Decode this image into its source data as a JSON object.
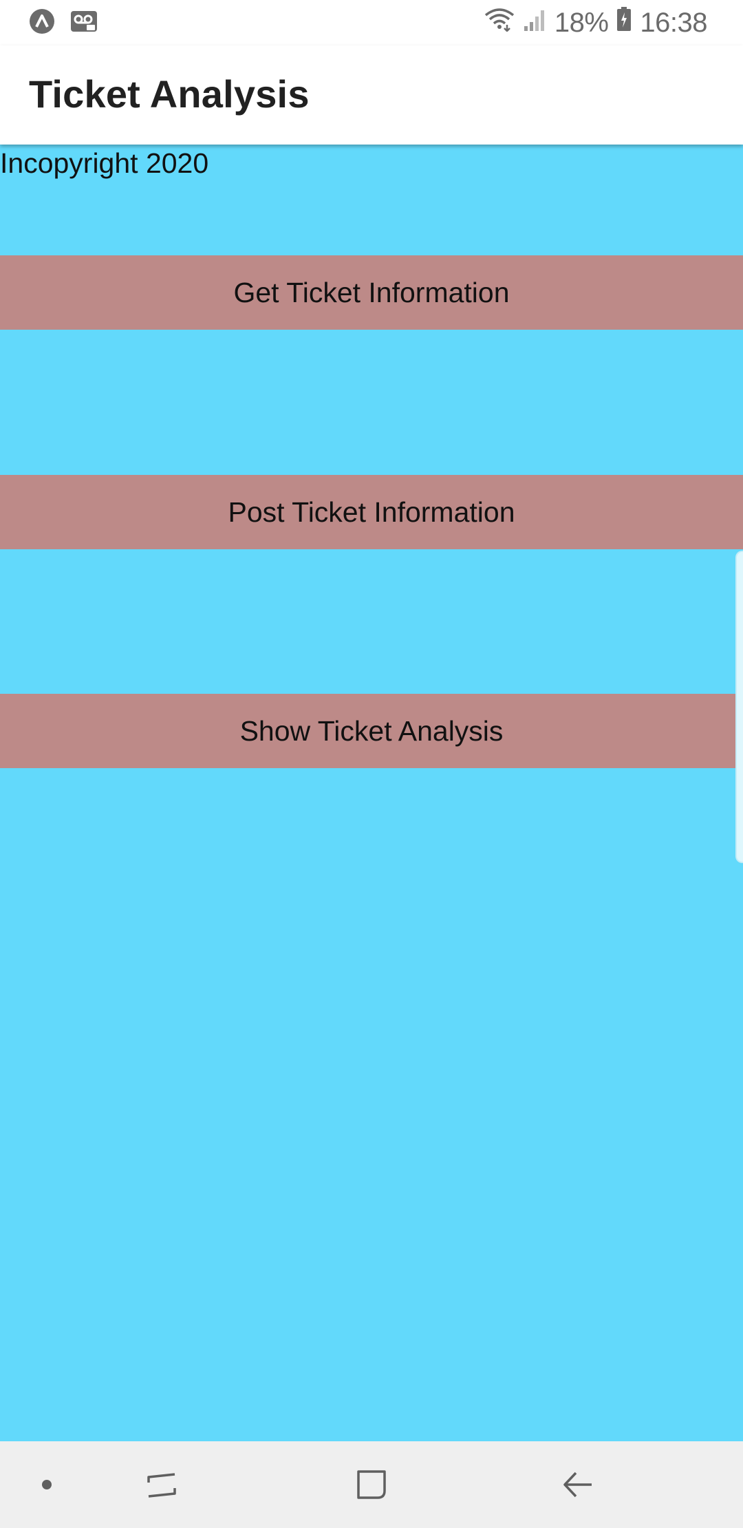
{
  "status_bar": {
    "left_icons": [
      "app-notification-icon",
      "voicemail-icon"
    ],
    "right_icons": [
      "wifi-icon",
      "signal-icon",
      "battery-icon"
    ],
    "battery": "18%",
    "time": "16:38"
  },
  "app_bar": {
    "title": "Ticket Analysis"
  },
  "main": {
    "copyright": "Incopyright 2020",
    "buttons": [
      {
        "label": "Get Ticket Information"
      },
      {
        "label": "Post Ticket Information"
      },
      {
        "label": "Show Ticket Analysis"
      }
    ]
  },
  "nav_bar": {
    "items": [
      "nav-dot-icon",
      "recent-apps-icon",
      "home-icon",
      "back-icon"
    ]
  },
  "colors": {
    "content_background": "#62d9fb",
    "button_background": "#bd8a88",
    "app_bar_background": "#ffffff",
    "nav_bar_background": "#efefef"
  }
}
